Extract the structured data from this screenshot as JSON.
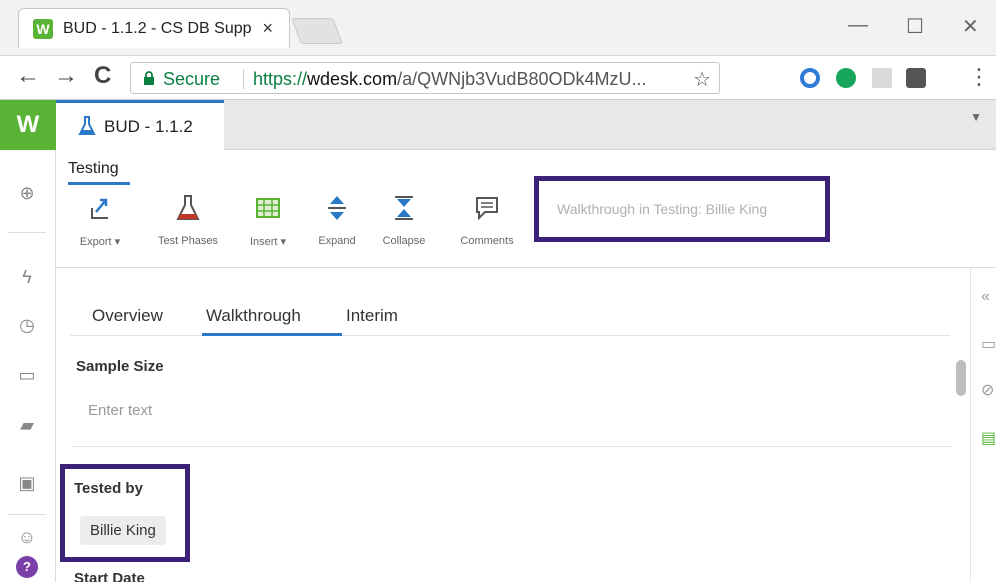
{
  "browser": {
    "tab_title": "BUD - 1.1.2 - CS DB Supp",
    "tab_close": "×",
    "favicon_letter": "W",
    "window_controls": {
      "minimize": "—",
      "maximize": "☐",
      "close": "✕"
    },
    "nav": {
      "back": "←",
      "forward": "→",
      "reload": "C"
    },
    "secure_label": "Secure",
    "url_scheme": "https://",
    "url_host": "wdesk.com",
    "url_path": "/a/QWNjb3VudB80ODk4MzU...",
    "bookmark_icon": "star-icon",
    "extensions": [
      "opera-icon",
      "grammarly-icon",
      "pdf-icon",
      "extension-icon"
    ],
    "menu": "⋮"
  },
  "app": {
    "logo": "W",
    "document_tab": "BUD - 1.1.2",
    "ribbon": {
      "section_title": "Testing",
      "tools": [
        {
          "label": "Export ▾",
          "icon": "export-icon"
        },
        {
          "label": "Test Phases",
          "icon": "flask-icon"
        },
        {
          "label": "Insert ▾",
          "icon": "table-insert-icon"
        },
        {
          "label": "Expand",
          "icon": "expand-icon"
        },
        {
          "label": "Collapse",
          "icon": "collapse-icon"
        },
        {
          "label": "Comments",
          "icon": "comment-icon"
        }
      ],
      "title_chip": "Walkthrough in Testing: Billie King"
    },
    "subtabs": [
      {
        "label": "Overview",
        "active": false
      },
      {
        "label": "Walkthrough",
        "active": true
      },
      {
        "label": "Interim",
        "active": false
      }
    ],
    "fields": {
      "sample_size_label": "Sample Size",
      "sample_size_placeholder": "Enter text",
      "tested_by_label": "Tested by",
      "tested_by_value": "Billie King",
      "start_date_label": "Start Date"
    },
    "left_rail_icons": [
      "plus-circle-icon",
      "lightning-icon",
      "clock-icon",
      "folder-icon",
      "inbox-icon",
      "folder-settings-icon",
      "user-circle-icon",
      "help-icon"
    ],
    "right_rail_icons": [
      "collapse-panel-icon",
      "comment-icon",
      "attachment-icon",
      "table-icon"
    ]
  },
  "colors": {
    "brand_green": "#59b435",
    "accent_blue": "#2a78c7",
    "highlight_purple": "#3b2278",
    "secure_green": "#0b8043"
  }
}
